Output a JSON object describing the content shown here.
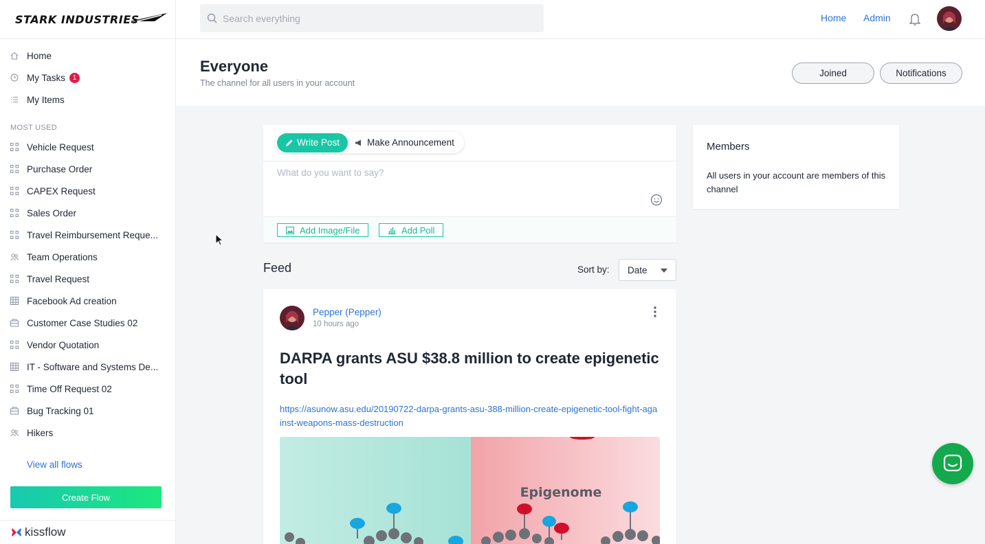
{
  "brand": {
    "name": "STARK INDUSTRIES",
    "footer": "kissflow"
  },
  "sidebar": {
    "primary": [
      {
        "label": "Home",
        "icon": "home-icon"
      },
      {
        "label": "My Tasks",
        "icon": "clock-icon",
        "badge": "1"
      },
      {
        "label": "My Items",
        "icon": "list-icon"
      }
    ],
    "section_label": "MOST USED",
    "flows": [
      {
        "label": "Vehicle Request",
        "icon": "process-icon"
      },
      {
        "label": "Purchase Order",
        "icon": "process-icon"
      },
      {
        "label": "CAPEX Request",
        "icon": "process-icon"
      },
      {
        "label": "Sales Order",
        "icon": "process-icon"
      },
      {
        "label": "Travel Reimbursement Reque...",
        "icon": "process-icon"
      },
      {
        "label": "Team Operations",
        "icon": "people-icon"
      },
      {
        "label": "Travel Request",
        "icon": "process-icon"
      },
      {
        "label": "Facebook Ad creation",
        "icon": "grid-icon"
      },
      {
        "label": "Customer Case Studies 02",
        "icon": "case-icon"
      },
      {
        "label": "Vendor Quotation",
        "icon": "process-icon"
      },
      {
        "label": "IT - Software and Systems De...",
        "icon": "grid-icon"
      },
      {
        "label": "Time Off Request 02",
        "icon": "process-icon"
      },
      {
        "label": "Bug Tracking 01",
        "icon": "case-icon"
      },
      {
        "label": "Hikers",
        "icon": "people-icon"
      }
    ],
    "view_all": "View all flows",
    "create_flow": "Create Flow"
  },
  "topbar": {
    "search_placeholder": "Search everything",
    "links": [
      "Home",
      "Admin"
    ]
  },
  "channel": {
    "title": "Everyone",
    "subtitle": "The channel for all users in your account",
    "joined_label": "Joined",
    "notifications_label": "Notifications"
  },
  "composer": {
    "tab_write": "Write Post",
    "tab_announce": "Make Announcement",
    "placeholder": "What do you want to say?",
    "add_image": "Add Image/File",
    "add_poll": "Add Poll"
  },
  "feed": {
    "title": "Feed",
    "sort_label": "Sort by:",
    "sort_value": "Date"
  },
  "post": {
    "author": "Pepper (Pepper)",
    "time": "10 hours ago",
    "title": "DARPA grants ASU $38.8 million to create epigenetic tool",
    "link": "https://asunow.asu.edu/20190722-darpa-grants-asu-388-million-create-epigenetic-tool-fight-against-weapons-mass-destruction",
    "image_caption": "Epigenome"
  },
  "members": {
    "title": "Members",
    "description": "All users in your account are members of this channel"
  },
  "colors": {
    "accent": "#18c6a6",
    "link": "#2b74d8",
    "badge": "#e6194b",
    "chat": "#13a94c"
  }
}
